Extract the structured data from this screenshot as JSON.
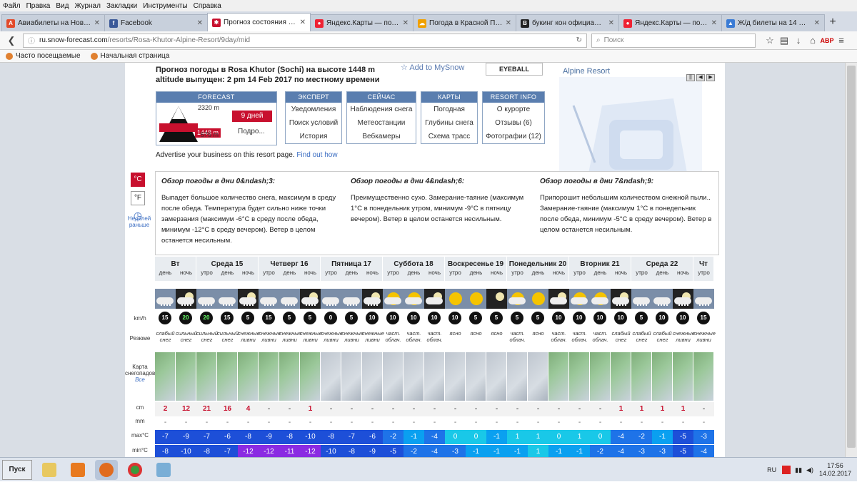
{
  "menu": [
    "Файл",
    "Правка",
    "Вид",
    "Журнал",
    "Закладки",
    "Инструменты",
    "Справка"
  ],
  "tabs": [
    {
      "label": "Авиабилеты на Новый 2...",
      "color": "#e24a2a",
      "glyph": "A"
    },
    {
      "label": "Facebook",
      "color": "#3b5998",
      "glyph": "f"
    },
    {
      "label": "Прогноз состояния снег...",
      "color": "#c8102e",
      "glyph": "✱",
      "active": true
    },
    {
      "label": "Яндекс.Карты — подро...",
      "color": "#e23",
      "glyph": "●"
    },
    {
      "label": "Погода в Красной Поля...",
      "color": "#f0a000",
      "glyph": "☁"
    },
    {
      "label": "букинг кон официальны...",
      "color": "#222",
      "glyph": "B"
    },
    {
      "label": "Яндекс.Карты — подро...",
      "color": "#e23",
      "glyph": "●"
    },
    {
      "label": "Ж/д билеты на 14 февр...",
      "color": "#3a7bd5",
      "glyph": "▲"
    }
  ],
  "url": {
    "domain": "ru.snow-forecast.com",
    "path": "/resorts/Rosa-Khutor-Alpine-Resort/9day/mid"
  },
  "search_placeholder": "Поиск",
  "bookmarks": [
    "Часто посещаемые",
    "Начальная страница"
  ],
  "header": {
    "line1": "Прогноз погоды в Rosa Khutor (Sochi) на высоте 1448 m",
    "line2": "altitude выпущен: 2 pm  14 Feb 2017 по местному времени",
    "add": "Add to MySnow",
    "eyeball": "EYEBALL",
    "resort": "Alpine Resort"
  },
  "nav": {
    "forecast": {
      "title": "FORECAST",
      "elev_top": "2320 m",
      "elev_mid": "1448 m",
      "elev_bot": "575 m",
      "days": "9 дней",
      "detail": "Подро..."
    },
    "expert": {
      "title": "ЭКСПЕРТ",
      "items": [
        "Уведомления",
        "Поиск условий",
        "История"
      ]
    },
    "now": {
      "title": "СЕЙЧАС",
      "items": [
        "Наблюдения снега",
        "Метеостанции",
        "Вебкамеры"
      ]
    },
    "maps": {
      "title": "КАРТЫ",
      "items": [
        "Погодная",
        "Глубины снега",
        "Схема трасс"
      ]
    },
    "info": {
      "title": "RESORT INFO",
      "items": [
        "О курорте",
        "Отзывы (6)",
        "Фотографии (12)"
      ]
    }
  },
  "advert": {
    "text": "Advertise your business on this resort page.",
    "link": "Find out how"
  },
  "units": {
    "c": "°C",
    "f": "°F",
    "earlier": "Неделей раньше"
  },
  "summary": [
    {
      "title": "Обзор погоды в дни 0&ndash;3:",
      "text": "Выпадет большое количество снега, максимум в среду после обеда. Температура будет сильно ниже точки замерзания (максимум -6°C в среду после обеда, минимум -12°C в среду вечером). Ветер в целом останется несильным."
    },
    {
      "title": "Обзор погоды в дни 4&ndash;6:",
      "text": "Преимущественно сухо. Замерание-таяние (максимум 1°C в понедельник утром, минимум -9°C в пятницу вечером). Ветер в целом останется несильным."
    },
    {
      "title": "Обзор погоды в дни 7&ndash;9:",
      "text": "Припорошит небольшим количеством снежной пыли.. Замерание-таяние (максимум 1°C в понедельник после обеда, минимум -5°C в среду вечером). Ветер в целом останется несильным."
    }
  ],
  "row_labels": {
    "wind": "km/h",
    "summary": "Резюме",
    "map": "Карта снегопадов",
    "map_all": "Все",
    "snow": "cm",
    "rain": "mm",
    "max": "max°C",
    "min": "min°C"
  },
  "days": [
    {
      "name": "Вт",
      "slots": [
        "день",
        "ночь"
      ]
    },
    {
      "name": "Среда 15",
      "slots": [
        "утро",
        "день",
        "ночь"
      ]
    },
    {
      "name": "Четверг 16",
      "slots": [
        "утро",
        "день",
        "ночь"
      ]
    },
    {
      "name": "Пятница 17",
      "slots": [
        "утро",
        "день",
        "ночь"
      ]
    },
    {
      "name": "Суббота 18",
      "slots": [
        "утро",
        "день",
        "ночь"
      ]
    },
    {
      "name": "Воскресенье 19",
      "slots": [
        "утро",
        "день",
        "ночь"
      ]
    },
    {
      "name": "Понедельник 20",
      "slots": [
        "утро",
        "день",
        "ночь"
      ]
    },
    {
      "name": "Вторник 21",
      "slots": [
        "утро",
        "день",
        "ночь"
      ]
    },
    {
      "name": "Среда 22",
      "slots": [
        "утро",
        "день",
        "ночь"
      ]
    },
    {
      "name": "Чт",
      "slots": [
        "утро"
      ]
    }
  ],
  "cells": [
    {
      "icon": "snow",
      "wind": "15",
      "desc": "слабый снег",
      "snow": "2",
      "rain": "-",
      "max": -7,
      "min": -8
    },
    {
      "icon": "snow-night",
      "wind": "20",
      "wg": true,
      "desc": "сильный снег",
      "snow": "12",
      "rain": "-",
      "max": -9,
      "min": -10
    },
    {
      "icon": "snow",
      "wind": "20",
      "wg": true,
      "desc": "сильный снег",
      "snow": "21",
      "rain": "-",
      "max": -7,
      "min": -8
    },
    {
      "icon": "snow",
      "wind": "15",
      "desc": "сильный снег",
      "snow": "16",
      "rain": "-",
      "max": -6,
      "min": -7
    },
    {
      "icon": "snow-night",
      "wind": "5",
      "desc": "снежные ливни",
      "snow": "4",
      "rain": "-",
      "max": -8,
      "min": -12
    },
    {
      "icon": "snow",
      "wind": "15",
      "desc": "снежные ливни",
      "snow": "-",
      "rain": "-",
      "max": -9,
      "min": -12
    },
    {
      "icon": "snow",
      "wind": "5",
      "desc": "снежные ливни",
      "snow": "-",
      "rain": "-",
      "max": -8,
      "min": -11
    },
    {
      "icon": "snow-night",
      "wind": "5",
      "desc": "снежные ливни",
      "snow": "1",
      "rain": "-",
      "max": -10,
      "min": -12
    },
    {
      "icon": "snow",
      "wind": "0",
      "desc": "снежные ливни",
      "snow": "-",
      "rain": "-",
      "max": -8,
      "min": -10
    },
    {
      "icon": "snow",
      "wind": "5",
      "desc": "снежные ливни",
      "snow": "-",
      "rain": "-",
      "max": -7,
      "min": -8
    },
    {
      "icon": "snow-night",
      "wind": "10",
      "desc": "снежные ливни",
      "snow": "-",
      "rain": "-",
      "max": -6,
      "min": -9
    },
    {
      "icon": "partsun",
      "wind": "10",
      "desc": "част. облач.",
      "snow": "-",
      "rain": "-",
      "max": -2,
      "min": -5
    },
    {
      "icon": "partsun",
      "wind": "10",
      "desc": "част. облач.",
      "snow": "-",
      "rain": "-",
      "max": -1,
      "min": -2
    },
    {
      "icon": "partmoon",
      "wind": "10",
      "desc": "част. облач.",
      "snow": "-",
      "rain": "-",
      "max": -4,
      "min": -4
    },
    {
      "icon": "sun",
      "wind": "10",
      "desc": "ясно",
      "snow": "-",
      "rain": "-",
      "max": 0,
      "min": -3
    },
    {
      "icon": "sun",
      "wind": "5",
      "desc": "ясно",
      "snow": "-",
      "rain": "-",
      "max": 0,
      "min": -1
    },
    {
      "icon": "moon",
      "wind": "5",
      "desc": "ясно",
      "snow": "-",
      "rain": "-",
      "max": -1,
      "min": -1
    },
    {
      "icon": "partsun",
      "wind": "5",
      "desc": "част. облач.",
      "snow": "-",
      "rain": "-",
      "max": 1,
      "min": -1
    },
    {
      "icon": "sun",
      "wind": "5",
      "desc": "ясно",
      "snow": "-",
      "rain": "-",
      "max": 1,
      "min": 1
    },
    {
      "icon": "partmoon",
      "wind": "10",
      "desc": "част. облач.",
      "snow": "-",
      "rain": "-",
      "max": 0,
      "min": -1
    },
    {
      "icon": "partsun",
      "wind": "10",
      "desc": "част. облач.",
      "snow": "-",
      "rain": "-",
      "max": 1,
      "min": -1
    },
    {
      "icon": "partsun",
      "wind": "10",
      "desc": "част. облач.",
      "snow": "-",
      "rain": "-",
      "max": 0,
      "min": -2
    },
    {
      "icon": "snow-night",
      "wind": "10",
      "desc": "слабый снег",
      "snow": "1",
      "rain": "-",
      "max": -4,
      "min": -4
    },
    {
      "icon": "snow",
      "wind": "5",
      "desc": "слабый снег",
      "snow": "1",
      "rain": "-",
      "max": -2,
      "min": -3
    },
    {
      "icon": "snow",
      "wind": "10",
      "desc": "слабый снег",
      "snow": "1",
      "rain": "-",
      "max": -1,
      "min": -3
    },
    {
      "icon": "snow-night",
      "wind": "10",
      "desc": "снежные ливни",
      "snow": "1",
      "rain": "-",
      "max": -5,
      "min": -5
    },
    {
      "icon": "snow",
      "wind": "15",
      "desc": "снежные ливни",
      "snow": "-",
      "rain": "-",
      "max": -3,
      "min": -4
    }
  ],
  "taskbar": {
    "start": "Пуск",
    "lang": "RU",
    "time": "17:56",
    "date": "14.02.2017"
  }
}
